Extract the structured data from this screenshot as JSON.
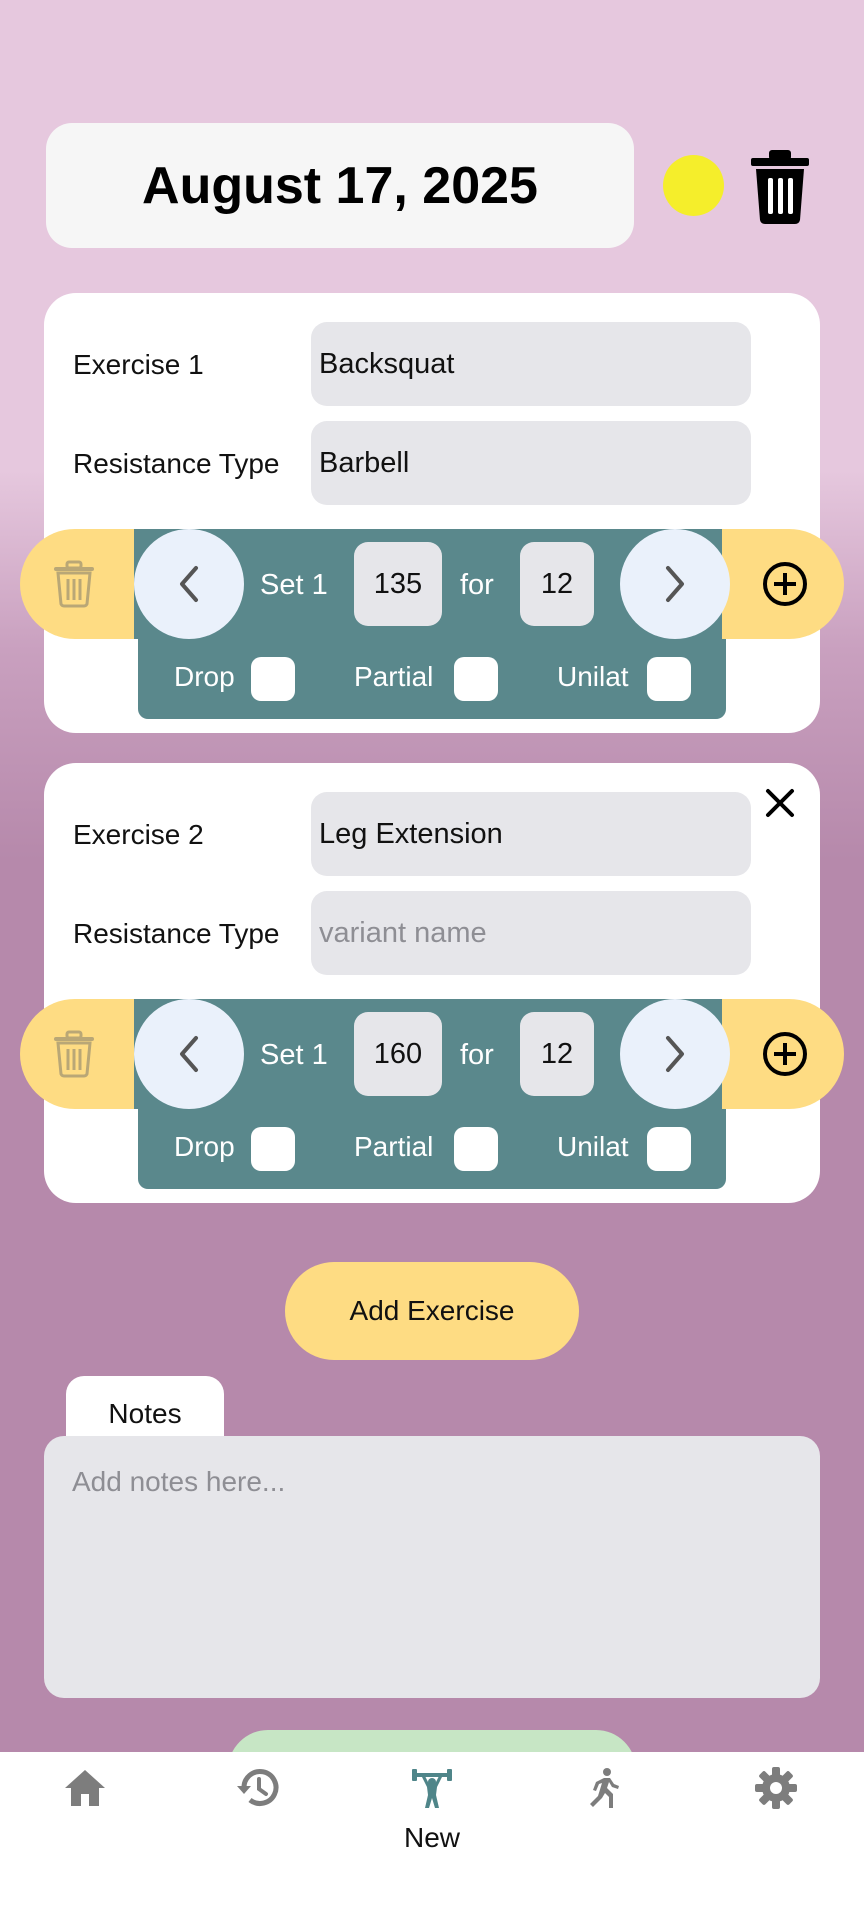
{
  "header": {
    "date": "August 17, 2025",
    "status_color": "#f5ee2b"
  },
  "exercises": [
    {
      "label": "Exercise 1",
      "name": "Backsquat",
      "resistance_label": "Resistance Type",
      "resistance_value": "Barbell",
      "resistance_placeholder": "",
      "set_label": "Set 1",
      "weight": "135",
      "for_label": "for",
      "reps": "12",
      "drop_label": "Drop",
      "partial_label": "Partial",
      "unilat_label": "Unilat"
    },
    {
      "label": "Exercise 2",
      "name": "Leg Extension",
      "resistance_label": "Resistance Type",
      "resistance_value": "",
      "resistance_placeholder": "variant name",
      "set_label": "Set 1",
      "weight": "160",
      "for_label": "for",
      "reps": "12",
      "drop_label": "Drop",
      "partial_label": "Partial",
      "unilat_label": "Unilat"
    }
  ],
  "add_exercise_label": "Add Exercise",
  "notes": {
    "tab_label": "Notes",
    "placeholder": "Add notes here..."
  },
  "bottom_nav": {
    "items": [
      {
        "icon": "home-icon",
        "label": ""
      },
      {
        "icon": "history-icon",
        "label": ""
      },
      {
        "icon": "dumbbell-icon",
        "label": "New"
      },
      {
        "icon": "runner-icon",
        "label": ""
      },
      {
        "icon": "gear-icon",
        "label": ""
      }
    ],
    "active_color": "#4f8589",
    "inactive_color": "#7d7d7d"
  },
  "colors": {
    "card_bg": "#ffffff",
    "pill_yellow": "#fedc83",
    "teal": "#5a888c",
    "field_gray": "#e6e6ea"
  }
}
